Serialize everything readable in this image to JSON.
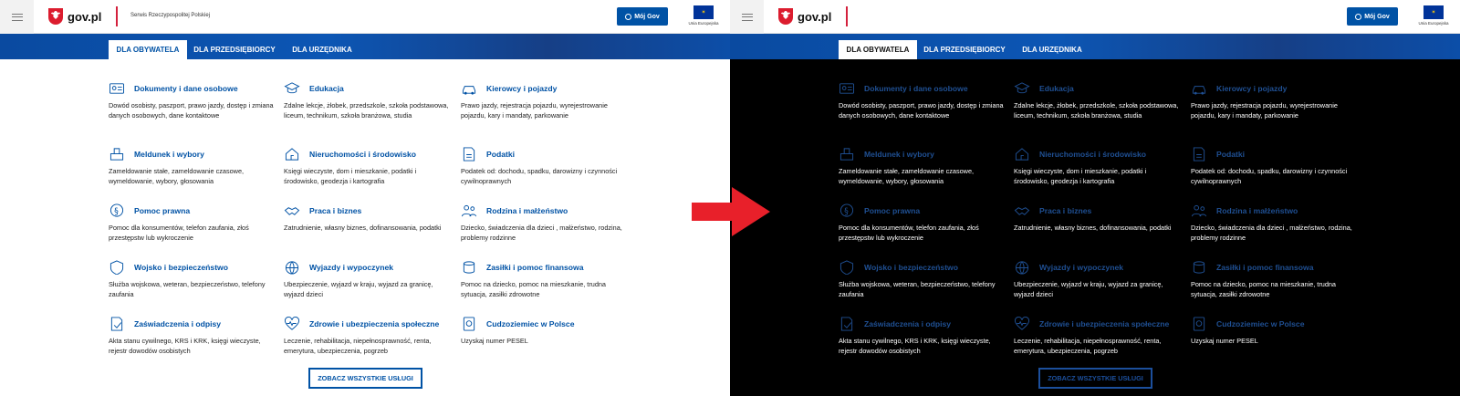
{
  "header": {
    "logo_text": "gov.pl",
    "service_name": "Serwis Rzeczypospolitej Polskiej",
    "account_button": "Mój Gov",
    "eu_label": "Unia Europejska"
  },
  "tabs": [
    {
      "label": "DLA OBYWATELA",
      "active": true
    },
    {
      "label": "DLA PRZEDSIĘBIORCY",
      "active": false
    },
    {
      "label": "DLA URZĘDNIKA",
      "active": false
    }
  ],
  "categories": [
    {
      "title": "Dokumenty i dane osobowe",
      "desc": "Dowód osobisty, paszport, prawo jazdy, dostęp i zmiana danych osobowych, dane kontaktowe",
      "icon": "id-card-icon"
    },
    {
      "title": "Edukacja",
      "desc": "Zdalne lekcje, żłobek, przedszkole, szkoła podstawowa, liceum, technikum, szkoła branżowa, studia",
      "icon": "graduation-cap-icon"
    },
    {
      "title": "Kierowcy i pojazdy",
      "desc": "Prawo jazdy, rejestracja pojazdu, wyrejestrowanie pojazdu, kary i mandaty, parkowanie",
      "icon": "car-icon"
    },
    {
      "title": "Meldunek i wybory",
      "desc": "Zameldowanie stałe, zameldowanie czasowe, wymeldowanie, wybory, głosowania",
      "icon": "ballot-box-icon"
    },
    {
      "title": "Nieruchomości i środowisko",
      "desc": "Księgi wieczyste, dom i mieszkanie, podatki i środowisko, geodezja i kartografia",
      "icon": "house-leaf-icon"
    },
    {
      "title": "Podatki",
      "desc": "Podatek od: dochodu, spadku, darowizny i czynności cywilnoprawnych",
      "icon": "tax-document-icon"
    },
    {
      "title": "Pomoc prawna",
      "desc": "Pomoc dla konsumentów, telefon zaufania, złoś przestępstw lub wykroczenie",
      "icon": "paragraph-icon"
    },
    {
      "title": "Praca i biznes",
      "desc": "Zatrudnienie, własny biznes, dofinansowania, podatki",
      "icon": "handshake-icon"
    },
    {
      "title": "Rodzina i małżeństwo",
      "desc": "Dziecko, świadczenia dla dzieci , małżeństwo, rodzina, problemy rodzinne",
      "icon": "family-icon"
    },
    {
      "title": "Wojsko i bezpieczeństwo",
      "desc": "Służba wojskowa, weteran, bezpieczeństwo, telefony zaufania",
      "icon": "shield-icon"
    },
    {
      "title": "Wyjazdy i wypoczynek",
      "desc": "Ubezpieczenie, wyjazd w kraju, wyjazd za granicę, wyjazd dzieci",
      "icon": "globe-icon"
    },
    {
      "title": "Zasiłki i pomoc finansowa",
      "desc": "Pomoc na dziecko, pomoc na mieszkanie, trudna sytuacja, zasiłki zdrowotne",
      "icon": "coins-icon"
    },
    {
      "title": "Zaświadczenia i odpisy",
      "desc": "Akta stanu cywilnego, KRS i KRK, księgi wieczyste, rejestr dowodów osobistych",
      "icon": "certificate-icon"
    },
    {
      "title": "Zdrowie i ubezpieczenia społeczne",
      "desc": "Leczenie, rehabilitacja, niepełnosprawność, renta, emerytura, ubezpieczenia, pogrzeb",
      "icon": "heart-pulse-icon"
    },
    {
      "title": "Cudzoziemiec w Polsce",
      "desc": "Uzyskaj numer PESEL",
      "icon": "passport-icon"
    }
  ],
  "all_services_button": "ZOBACZ WSZYSTKIE USŁUGI",
  "colors": {
    "brand_blue": "#0052a5",
    "red": "#d4213d",
    "arrow_red": "#e8202a"
  }
}
